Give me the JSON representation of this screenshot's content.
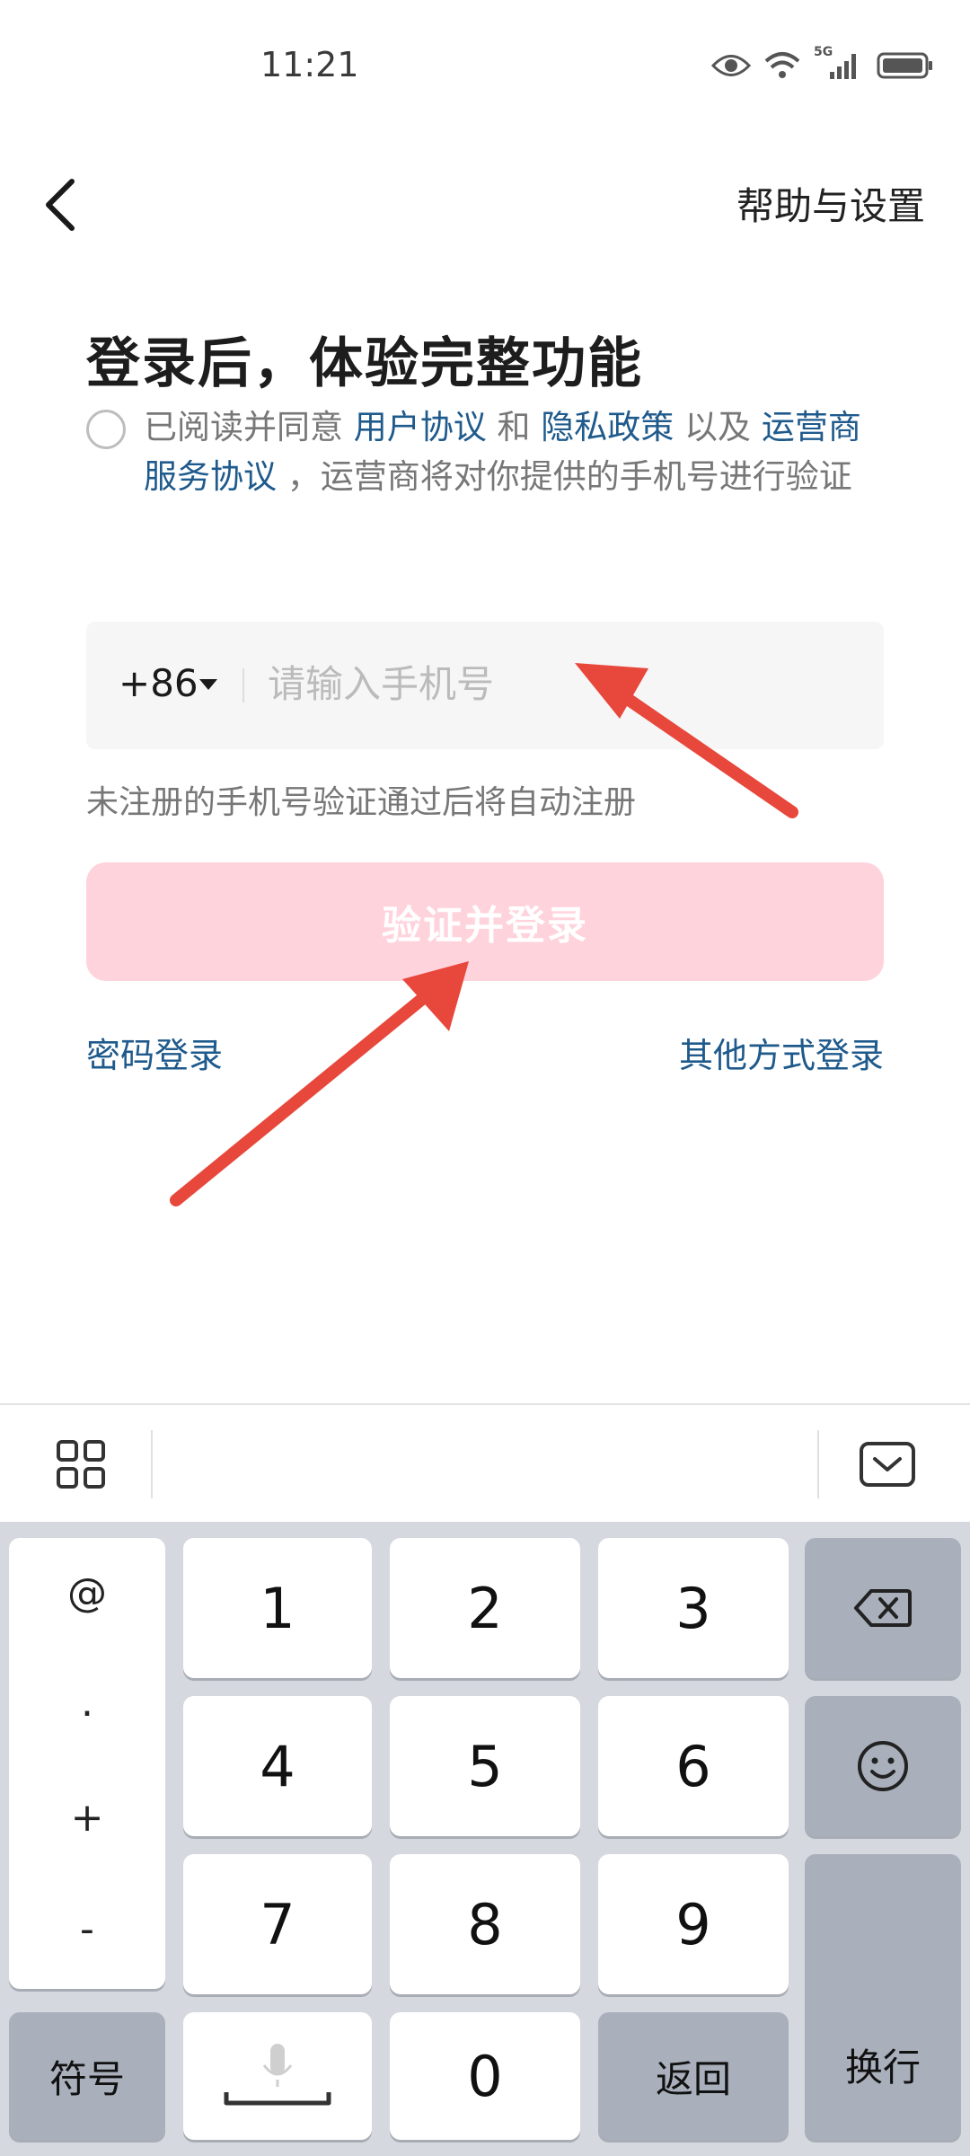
{
  "status_bar": {
    "time": "11:21",
    "network": "5G"
  },
  "header": {
    "help_settings": "帮助与设置"
  },
  "title": "登录后，体验完整功能",
  "agreement": {
    "prefix": "已阅读并同意 ",
    "user_agreement": "用户协议",
    "and": " 和 ",
    "privacy_policy": "隐私政策",
    "and2": " 以及 ",
    "carrier_agreement": "运营商服务协议",
    "suffix": " ，运营商将对你提供的手机号进行验证"
  },
  "phone": {
    "country_code": "+86",
    "placeholder": "请输入手机号",
    "value": ""
  },
  "hint": "未注册的手机号验证通过后将自动注册",
  "login_button": "验证并登录",
  "password_login": "密码登录",
  "other_login": "其他方式登录",
  "keyboard": {
    "side_keys": [
      "@",
      ".",
      "+",
      "-"
    ],
    "digits": [
      "1",
      "2",
      "3",
      "4",
      "5",
      "6",
      "7",
      "8",
      "9",
      "0"
    ],
    "symbols": "符号",
    "return": "返回",
    "newline": "换行"
  },
  "colors": {
    "accent_link": "#1f5a8c",
    "button_bg": "#ffd3dc",
    "arrow": "#e8473b"
  }
}
